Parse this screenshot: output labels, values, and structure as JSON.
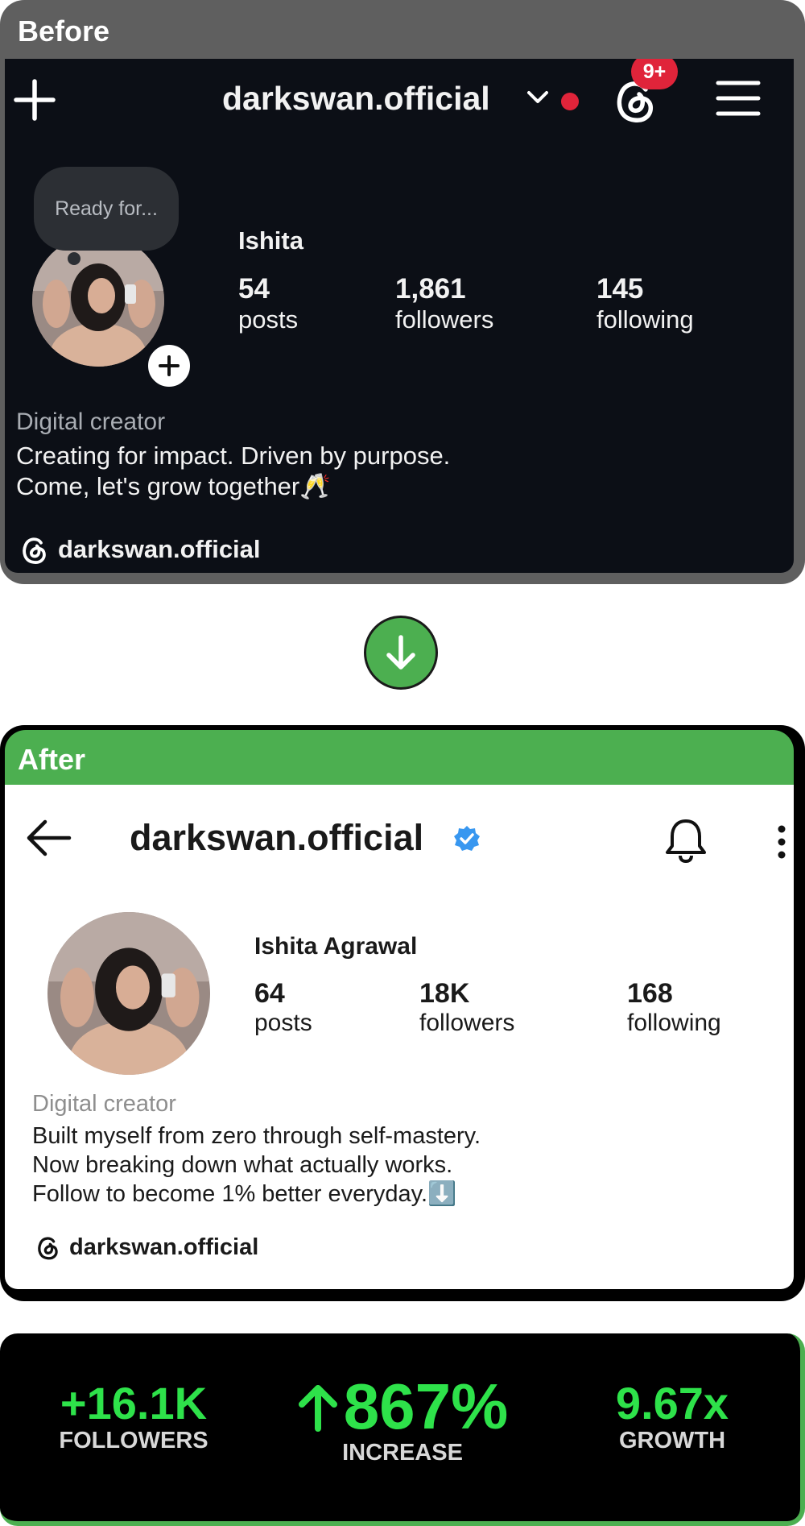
{
  "before": {
    "header": "Before",
    "username": "darkswan.official",
    "notification_badge": "9+",
    "bubble_text": "Ready for...",
    "name": "Ishita",
    "stats": [
      {
        "value": "54",
        "label": "posts"
      },
      {
        "value": "1,861",
        "label": "followers"
      },
      {
        "value": "145",
        "label": "following"
      }
    ],
    "category": "Digital creator",
    "bio_lines": [
      "Creating for impact. Driven by purpose.",
      "Come, let's grow together🥂"
    ],
    "threads_handle": "darkswan.official"
  },
  "after": {
    "header": "After",
    "username": "darkswan.official",
    "name": "Ishita Agrawal",
    "stats": [
      {
        "value": "64",
        "label": "posts"
      },
      {
        "value": "18K",
        "label": "followers"
      },
      {
        "value": "168",
        "label": "following"
      }
    ],
    "category": "Digital creator",
    "bio_lines": [
      "Built myself from zero through self-mastery.",
      "Now breaking down what actually works.",
      "Follow to become 1% better everyday.⬇️"
    ],
    "threads_handle": "darkswan.official"
  },
  "results": [
    {
      "value": "+16.1K",
      "label": "FOLLOWERS"
    },
    {
      "value": "867%",
      "label": "INCREASE"
    },
    {
      "value": "9.67x",
      "label": "GROWTH"
    }
  ],
  "colors": {
    "accent_green": "#4caf50",
    "stat_green": "#2ee24a",
    "badge_red": "#e0243a",
    "verified_blue": "#3897f0"
  }
}
